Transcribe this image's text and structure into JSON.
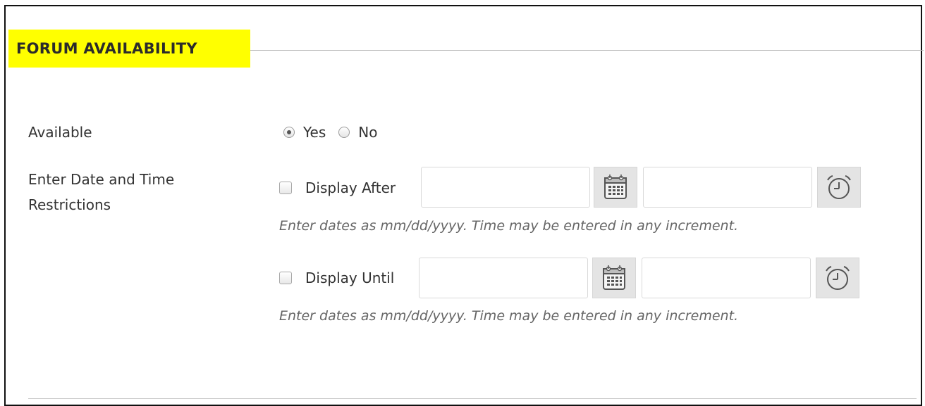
{
  "section": {
    "title": "FORUM AVAILABILITY",
    "highlight_color": "#ffff00"
  },
  "available": {
    "label": "Available",
    "options": [
      {
        "label": "Yes",
        "selected": true
      },
      {
        "label": "No",
        "selected": false
      }
    ]
  },
  "restrictions": {
    "label": "Enter Date and Time Restrictions",
    "display_after": {
      "label": "Display After",
      "checked": false,
      "date_value": "",
      "time_value": "",
      "calendar_icon": "calendar-icon",
      "clock_icon": "clock-icon",
      "hint": "Enter dates as mm/dd/yyyy. Time may be entered in any increment."
    },
    "display_until": {
      "label": "Display Until",
      "checked": false,
      "date_value": "",
      "time_value": "",
      "calendar_icon": "calendar-icon",
      "clock_icon": "clock-icon",
      "hint": "Enter dates as mm/dd/yyyy. Time may be entered in any increment."
    }
  }
}
